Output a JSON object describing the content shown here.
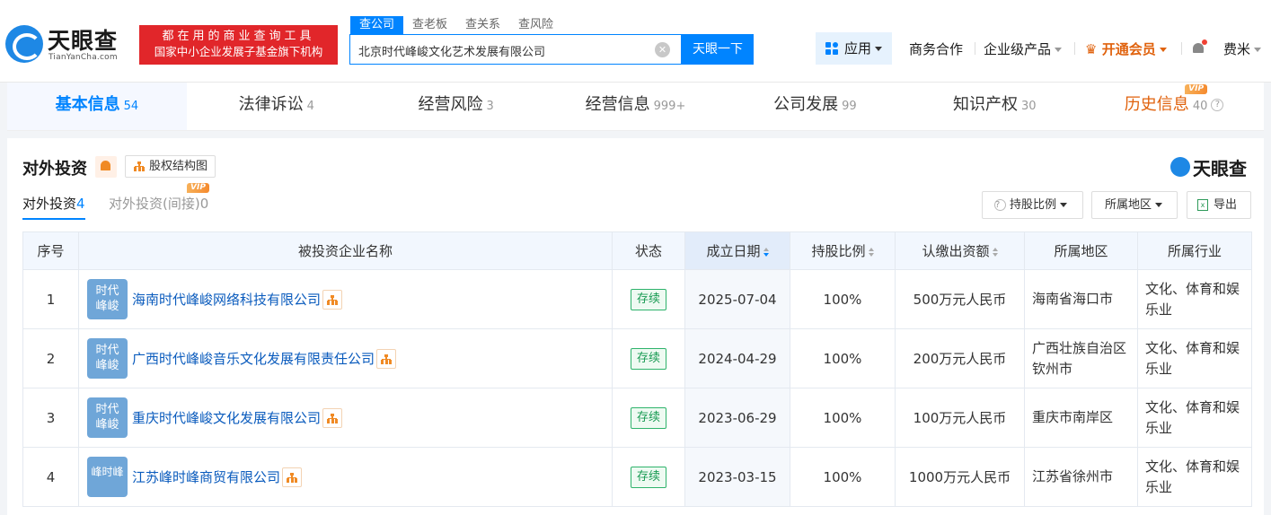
{
  "header": {
    "logo_name": "天眼查",
    "logo_sub": "TianYanCha.com",
    "slogan_line1": "都在用的商业查询工具",
    "slogan_line2": "国家中小企业发展子基金旗下机构",
    "search_tabs": [
      "查公司",
      "查老板",
      "查关系",
      "查风险"
    ],
    "search_value": "北京时代峰峻文化艺术发展有限公司",
    "search_button": "天眼一下",
    "apps": "应用",
    "business": "商务合作",
    "enterprise": "企业级产品",
    "vip": "开通会员",
    "user": "费米"
  },
  "tabs": [
    {
      "label": "基本信息",
      "count": "54"
    },
    {
      "label": "法律诉讼",
      "count": "4"
    },
    {
      "label": "经营风险",
      "count": "3"
    },
    {
      "label": "经营信息",
      "count": "999+"
    },
    {
      "label": "公司发展",
      "count": "99"
    },
    {
      "label": "知识产权",
      "count": "30"
    },
    {
      "label": "历史信息",
      "count": "40"
    }
  ],
  "vip_badge": "VIP",
  "section": {
    "title": "对外投资",
    "struct_button": "股权结构图",
    "brand": "天眼查",
    "subtabs": [
      {
        "label": "对外投资",
        "count": "4"
      },
      {
        "label": "对外投资(间接)",
        "count": "0"
      }
    ],
    "filter_ratio": "持股比例",
    "filter_region": "所属地区",
    "export": "导出"
  },
  "table": {
    "columns": [
      "序号",
      "被投资企业名称",
      "状态",
      "成立日期",
      "持股比例",
      "认缴出资额",
      "所属地区",
      "所属行业"
    ],
    "rows": [
      {
        "no": "1",
        "logo1": "时代",
        "logo2": "峰峻",
        "name": "海南时代峰峻网络科技有限公司",
        "status": "存续",
        "date": "2025-07-04",
        "ratio": "100%",
        "capital": "500万元人民币",
        "region": "海南省海口市",
        "industry": "文化、体育和娱乐业"
      },
      {
        "no": "2",
        "logo1": "时代",
        "logo2": "峰峻",
        "name": "广西时代峰峻音乐文化发展有限责任公司",
        "status": "存续",
        "date": "2024-04-29",
        "ratio": "100%",
        "capital": "200万元人民币",
        "region": "广西壮族自治区钦州市",
        "industry": "文化、体育和娱乐业"
      },
      {
        "no": "3",
        "logo1": "时代",
        "logo2": "峰峻",
        "name": "重庆时代峰峻文化发展有限公司",
        "status": "存续",
        "date": "2023-06-29",
        "ratio": "100%",
        "capital": "100万元人民币",
        "region": "重庆市南岸区",
        "industry": "文化、体育和娱乐业"
      },
      {
        "no": "4",
        "logo1": "峰时峰",
        "logo2": "",
        "name": "江苏峰时峰商贸有限公司",
        "status": "存续",
        "date": "2023-03-15",
        "ratio": "100%",
        "capital": "1000万元人民币",
        "region": "江苏省徐州市",
        "industry": "文化、体育和娱乐业"
      }
    ]
  }
}
